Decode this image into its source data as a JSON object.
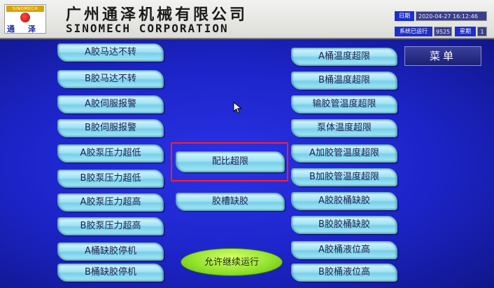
{
  "header": {
    "logo_top_text": "SINOMECH",
    "logo_left_char": "通",
    "logo_right_char": "泽",
    "company_cn": "广州通泽机械有限公司",
    "company_en": "SINOMECH CORPORATION",
    "date_label": "日期",
    "date_value": "2020-04-27 16:12:46",
    "runtime_label": "系统已运行",
    "runtime_value": "9525",
    "week_label": "星期",
    "week_value": "1"
  },
  "menu_label": "菜单",
  "left_alarms": [
    "A胶马达不转",
    "B胶马达不转",
    "A胶伺服报警",
    "B胶伺服报警",
    "A胶泵压力超低",
    "B胶泵压力超低",
    "A胶泵压力超高",
    "B胶泵压力超高",
    "A桶缺胶停机",
    "B桶缺胶停机"
  ],
  "middle_alarms": [
    "配比超限",
    "胶槽缺胶"
  ],
  "right_alarms": [
    "A桶温度超限",
    "B桶温度超限",
    "输胶管温度超限",
    "泵体温度超限",
    "A加胶管温度超限",
    "B加胶管温度超限",
    "A胶胶桶缺胶",
    "B胶胶桶缺胶",
    "A胶桶液位高",
    "B胶桶液位高"
  ],
  "continue_label": "允许继续运行",
  "colors": {
    "panel_blue": "#1c24c8",
    "alarm_button": "#9fe2f5",
    "highlight_red": "#ff1e2a",
    "continue_green": "#8de02a"
  }
}
